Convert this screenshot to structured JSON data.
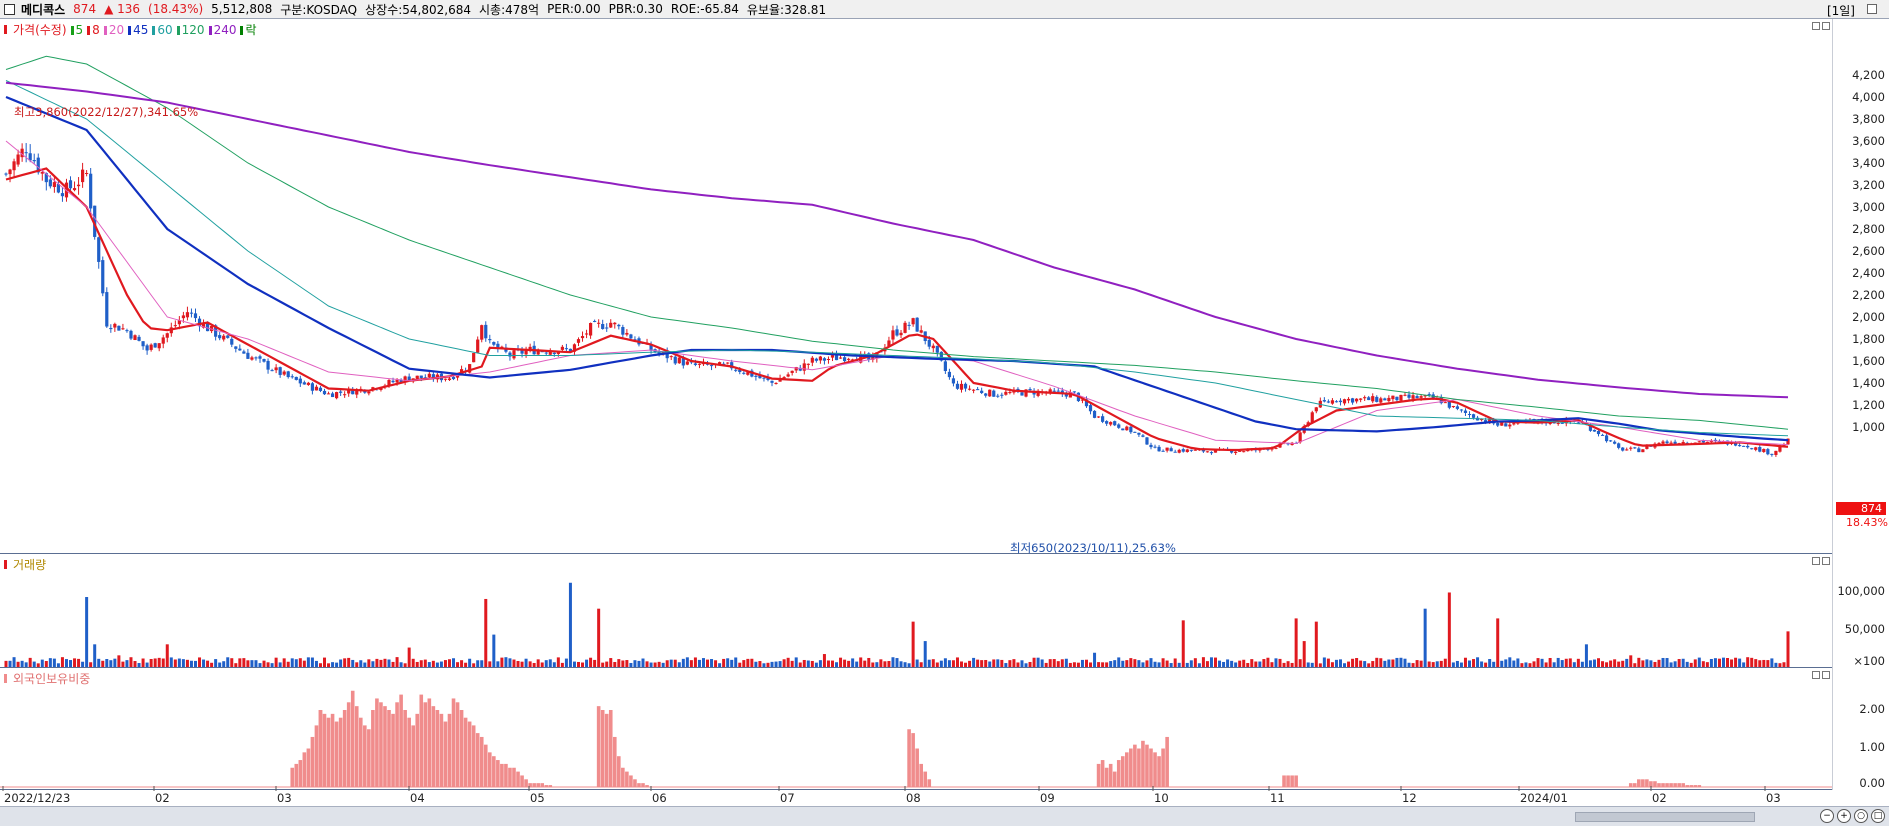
{
  "header": {
    "stock_name": "메디콕스",
    "price": "874",
    "change": "▲ 136",
    "change_pct": "(18.43%)",
    "volume": "5,512,808",
    "market": "구분:KOSDAQ",
    "shares": "상장수:54,802,684",
    "market_cap": "시총:478억",
    "per": "PER:0.00",
    "pbr": "PBR:0.30",
    "roe": "ROE:-65.84",
    "float_ratio": "유보율:328.81",
    "period": "[1일]"
  },
  "price_panel": {
    "legend_title": "가격(수정)",
    "ma_legend": [
      {
        "label": "5",
        "color": "#18a018"
      },
      {
        "label": "8",
        "color": "#e0191f"
      },
      {
        "label": "20",
        "color": "#e060c0"
      },
      {
        "label": "45",
        "color": "#1030c0"
      },
      {
        "label": "60",
        "color": "#20a0a0"
      },
      {
        "label": "120",
        "color": "#20a060"
      },
      {
        "label": "240",
        "color": "#9020c0"
      },
      {
        "label": "락",
        "color": "#008000"
      }
    ],
    "high_annotation": "최고3,860(2022/12/27),341.65%",
    "low_annotation": "최저650(2023/10/11),25.63%",
    "current_price_tag": "874",
    "current_pct": "18.43%",
    "y_ticks": [
      "4,200",
      "4,000",
      "3,800",
      "3,600",
      "3,400",
      "3,200",
      "3,000",
      "2,800",
      "2,600",
      "2,400",
      "2,200",
      "2,000",
      "1,800",
      "1,600",
      "1,400",
      "1,200",
      "1,000"
    ]
  },
  "volume_panel": {
    "legend_title": "거래량",
    "y_ticks": [
      "100,000",
      "50,000",
      "×100"
    ]
  },
  "foreign_panel": {
    "legend_title": "외국인보유비중",
    "y_ticks": [
      "2.00",
      "1.00",
      "0.00"
    ]
  },
  "x_axis": {
    "labels": [
      "2022/12/23",
      "02",
      "03",
      "04",
      "05",
      "06",
      "07",
      "08",
      "09",
      "10",
      "11",
      "12",
      "2024/01",
      "02",
      "03"
    ]
  },
  "colors": {
    "up": "#e0191f",
    "down": "#1f5fc8",
    "foreign_bar": "#f08c8c"
  },
  "chart_data": {
    "type": "line",
    "title": "",
    "price_anchors": [
      [
        0,
        3300
      ],
      [
        5,
        3550
      ],
      [
        10,
        3250
      ],
      [
        15,
        3150
      ],
      [
        20,
        3300
      ],
      [
        25,
        1950
      ],
      [
        30,
        1880
      ],
      [
        35,
        1700
      ],
      [
        40,
        1850
      ],
      [
        45,
        2050
      ],
      [
        50,
        1900
      ],
      [
        60,
        1650
      ],
      [
        70,
        1450
      ],
      [
        80,
        1300
      ],
      [
        90,
        1350
      ],
      [
        100,
        1450
      ],
      [
        110,
        1450
      ],
      [
        115,
        1560
      ],
      [
        118,
        1950
      ],
      [
        120,
        1750
      ],
      [
        125,
        1650
      ],
      [
        130,
        1700
      ],
      [
        140,
        1700
      ],
      [
        145,
        1900
      ],
      [
        150,
        1950
      ],
      [
        160,
        1700
      ],
      [
        170,
        1560
      ],
      [
        180,
        1550
      ],
      [
        190,
        1400
      ],
      [
        200,
        1600
      ],
      [
        210,
        1650
      ],
      [
        215,
        1600
      ],
      [
        220,
        1850
      ],
      [
        225,
        1950
      ],
      [
        230,
        1700
      ],
      [
        235,
        1380
      ],
      [
        245,
        1300
      ],
      [
        255,
        1320
      ],
      [
        265,
        1300
      ],
      [
        270,
        1100
      ],
      [
        280,
        950
      ],
      [
        285,
        800
      ],
      [
        290,
        790
      ],
      [
        300,
        780
      ],
      [
        310,
        790
      ],
      [
        320,
        860
      ],
      [
        325,
        1200
      ],
      [
        330,
        1250
      ],
      [
        340,
        1250
      ],
      [
        350,
        1270
      ],
      [
        355,
        1260
      ],
      [
        360,
        1150
      ],
      [
        370,
        1020
      ],
      [
        380,
        1050
      ],
      [
        390,
        1050
      ],
      [
        395,
        950
      ],
      [
        400,
        800
      ],
      [
        405,
        790
      ],
      [
        410,
        860
      ],
      [
        420,
        870
      ],
      [
        430,
        850
      ],
      [
        438,
        760
      ],
      [
        442,
        874
      ]
    ],
    "ma_series": [
      {
        "name": "8",
        "color": "#e0191f",
        "width": 2.2,
        "anchors": [
          [
            0,
            3250
          ],
          [
            10,
            3350
          ],
          [
            20,
            3000
          ],
          [
            25,
            2600
          ],
          [
            30,
            2200
          ],
          [
            35,
            1900
          ],
          [
            40,
            1880
          ],
          [
            50,
            1950
          ],
          [
            60,
            1750
          ],
          [
            70,
            1550
          ],
          [
            80,
            1350
          ],
          [
            90,
            1330
          ],
          [
            100,
            1420
          ],
          [
            110,
            1460
          ],
          [
            118,
            1550
          ],
          [
            120,
            1720
          ],
          [
            130,
            1700
          ],
          [
            140,
            1680
          ],
          [
            150,
            1830
          ],
          [
            160,
            1750
          ],
          [
            170,
            1600
          ],
          [
            180,
            1550
          ],
          [
            190,
            1440
          ],
          [
            200,
            1420
          ],
          [
            205,
            1550
          ],
          [
            215,
            1650
          ],
          [
            225,
            1850
          ],
          [
            230,
            1800
          ],
          [
            240,
            1400
          ],
          [
            250,
            1330
          ],
          [
            265,
            1300
          ],
          [
            275,
            1100
          ],
          [
            285,
            900
          ],
          [
            295,
            800
          ],
          [
            305,
            790
          ],
          [
            315,
            810
          ],
          [
            322,
            1000
          ],
          [
            330,
            1150
          ],
          [
            340,
            1200
          ],
          [
            350,
            1250
          ],
          [
            355,
            1260
          ],
          [
            360,
            1220
          ],
          [
            370,
            1050
          ],
          [
            380,
            1040
          ],
          [
            390,
            1060
          ],
          [
            400,
            900
          ],
          [
            405,
            830
          ],
          [
            415,
            840
          ],
          [
            430,
            860
          ],
          [
            442,
            820
          ]
        ]
      },
      {
        "name": "20",
        "color": "#e060c0",
        "width": 1,
        "anchors": [
          [
            0,
            3600
          ],
          [
            20,
            3000
          ],
          [
            40,
            2000
          ],
          [
            60,
            1800
          ],
          [
            80,
            1500
          ],
          [
            100,
            1420
          ],
          [
            120,
            1500
          ],
          [
            140,
            1650
          ],
          [
            160,
            1700
          ],
          [
            180,
            1600
          ],
          [
            200,
            1520
          ],
          [
            220,
            1650
          ],
          [
            240,
            1600
          ],
          [
            260,
            1370
          ],
          [
            280,
            1100
          ],
          [
            300,
            880
          ],
          [
            320,
            850
          ],
          [
            340,
            1150
          ],
          [
            360,
            1250
          ],
          [
            380,
            1100
          ],
          [
            400,
            1000
          ],
          [
            420,
            880
          ],
          [
            442,
            840
          ]
        ]
      },
      {
        "name": "45",
        "color": "#1030c0",
        "width": 2.2,
        "anchors": [
          [
            0,
            4000
          ],
          [
            20,
            3700
          ],
          [
            40,
            2800
          ],
          [
            60,
            2300
          ],
          [
            80,
            1900
          ],
          [
            100,
            1530
          ],
          [
            120,
            1450
          ],
          [
            140,
            1520
          ],
          [
            160,
            1650
          ],
          [
            170,
            1700
          ],
          [
            190,
            1700
          ],
          [
            210,
            1650
          ],
          [
            230,
            1620
          ],
          [
            250,
            1600
          ],
          [
            270,
            1550
          ],
          [
            290,
            1300
          ],
          [
            310,
            1050
          ],
          [
            320,
            980
          ],
          [
            340,
            960
          ],
          [
            355,
            1000
          ],
          [
            370,
            1050
          ],
          [
            380,
            1060
          ],
          [
            390,
            1080
          ],
          [
            400,
            1030
          ],
          [
            410,
            970
          ],
          [
            430,
            910
          ],
          [
            442,
            880
          ]
        ]
      },
      {
        "name": "60",
        "color": "#20a0a0",
        "width": 1,
        "anchors": [
          [
            0,
            4150
          ],
          [
            20,
            3800
          ],
          [
            40,
            3200
          ],
          [
            60,
            2600
          ],
          [
            80,
            2100
          ],
          [
            100,
            1800
          ],
          [
            120,
            1650
          ],
          [
            140,
            1650
          ],
          [
            160,
            1680
          ],
          [
            180,
            1700
          ],
          [
            200,
            1680
          ],
          [
            220,
            1650
          ],
          [
            240,
            1620
          ],
          [
            260,
            1580
          ],
          [
            280,
            1500
          ],
          [
            300,
            1400
          ],
          [
            320,
            1250
          ],
          [
            340,
            1100
          ],
          [
            360,
            1080
          ],
          [
            380,
            1060
          ],
          [
            400,
            1000
          ],
          [
            420,
            950
          ],
          [
            442,
            920
          ]
        ]
      },
      {
        "name": "120",
        "color": "#20a060",
        "width": 1,
        "anchors": [
          [
            0,
            4250
          ],
          [
            10,
            4370
          ],
          [
            20,
            4300
          ],
          [
            40,
            3900
          ],
          [
            60,
            3400
          ],
          [
            80,
            3000
          ],
          [
            100,
            2700
          ],
          [
            120,
            2450
          ],
          [
            140,
            2200
          ],
          [
            160,
            2000
          ],
          [
            180,
            1900
          ],
          [
            200,
            1780
          ],
          [
            220,
            1700
          ],
          [
            240,
            1640
          ],
          [
            260,
            1600
          ],
          [
            280,
            1560
          ],
          [
            300,
            1500
          ],
          [
            320,
            1420
          ],
          [
            340,
            1350
          ],
          [
            360,
            1250
          ],
          [
            380,
            1180
          ],
          [
            400,
            1100
          ],
          [
            420,
            1060
          ],
          [
            442,
            980
          ]
        ]
      },
      {
        "name": "240",
        "color": "#9020c0",
        "width": 2,
        "anchors": [
          [
            0,
            4130
          ],
          [
            20,
            4050
          ],
          [
            40,
            3950
          ],
          [
            60,
            3800
          ],
          [
            80,
            3650
          ],
          [
            100,
            3500
          ],
          [
            120,
            3380
          ],
          [
            140,
            3270
          ],
          [
            160,
            3160
          ],
          [
            180,
            3080
          ],
          [
            200,
            3020
          ],
          [
            220,
            2850
          ],
          [
            240,
            2700
          ],
          [
            260,
            2450
          ],
          [
            280,
            2250
          ],
          [
            300,
            2000
          ],
          [
            320,
            1800
          ],
          [
            340,
            1650
          ],
          [
            360,
            1530
          ],
          [
            380,
            1430
          ],
          [
            400,
            1360
          ],
          [
            420,
            1300
          ],
          [
            442,
            1270
          ]
        ]
      }
    ],
    "volume_spikes": [
      [
        20,
        1.08,
        "down"
      ],
      [
        22,
        0.35,
        "down"
      ],
      [
        28,
        0.18,
        "up"
      ],
      [
        40,
        0.35,
        "up"
      ],
      [
        100,
        0.3,
        "up"
      ],
      [
        119,
        1.05,
        "up"
      ],
      [
        121,
        0.5,
        "down"
      ],
      [
        140,
        1.3,
        "down"
      ],
      [
        147,
        0.9,
        "up"
      ],
      [
        203,
        0.2,
        "up"
      ],
      [
        225,
        0.7,
        "up"
      ],
      [
        228,
        0.4,
        "down"
      ],
      [
        270,
        0.22,
        "down"
      ],
      [
        292,
        0.72,
        "up"
      ],
      [
        320,
        0.75,
        "up"
      ],
      [
        322,
        0.4,
        "up"
      ],
      [
        325,
        0.7,
        "up"
      ],
      [
        352,
        0.9,
        "down"
      ],
      [
        358,
        1.15,
        "up"
      ],
      [
        370,
        0.75,
        "up"
      ],
      [
        392,
        0.35,
        "down"
      ],
      [
        403,
        0.18,
        "up"
      ],
      [
        442,
        0.55,
        "up"
      ]
    ],
    "foreign_runs": [
      [
        71,
        78,
        [
          0.5,
          0.6,
          0.7,
          0.9,
          1.0,
          1.3,
          1.6,
          2.0
        ]
      ],
      [
        78,
        100,
        [
          2.0,
          1.9,
          1.8,
          1.9,
          1.7,
          1.8,
          2.0,
          2.2,
          2.5,
          2.1,
          1.8,
          1.6,
          1.5,
          2.0,
          2.3,
          2.2,
          2.1,
          2.0,
          1.9,
          2.2,
          2.4,
          2.0
        ]
      ],
      [
        100,
        110,
        [
          1.8,
          1.6,
          1.9,
          2.4,
          2.2,
          2.3,
          2.1,
          2.0,
          1.9,
          1.7
        ]
      ],
      [
        110,
        137,
        [
          1.9,
          2.3,
          2.2,
          2.0,
          1.8,
          1.7,
          1.6,
          1.4,
          1.3,
          1.1,
          0.9,
          0.8,
          0.7,
          0.6,
          0.6,
          0.5,
          0.5,
          0.4,
          0.3,
          0.2,
          0.1,
          0.1,
          0.1,
          0.1,
          0.05,
          0.05,
          0.0
        ]
      ],
      [
        147,
        161,
        [
          2.1,
          2.0,
          1.9,
          2.0,
          1.3,
          0.8,
          0.5,
          0.4,
          0.3,
          0.2,
          0.1,
          0.1,
          0.05,
          0.0
        ]
      ],
      [
        224,
        230,
        [
          1.5,
          1.4,
          1.0,
          0.6,
          0.4,
          0.2
        ]
      ],
      [
        271,
        294,
        [
          0.6,
          0.7,
          0.5,
          0.6,
          0.4,
          0.7,
          0.8,
          0.9,
          1.0,
          1.1,
          1.0,
          1.2,
          1.1,
          1.0,
          0.9,
          0.8,
          1.0,
          1.3,
          0.0,
          0.0,
          0.0,
          0.0,
          0.0
        ]
      ],
      [
        317,
        321,
        [
          0.3,
          0.3,
          0.3,
          0.3
        ]
      ],
      [
        403,
        430,
        [
          0.1,
          0.1,
          0.2,
          0.2,
          0.2,
          0.15,
          0.15,
          0.1,
          0.1,
          0.1,
          0.1,
          0.1,
          0.1,
          0.1,
          0.05,
          0.05,
          0.05,
          0.05
        ]
      ]
    ]
  }
}
